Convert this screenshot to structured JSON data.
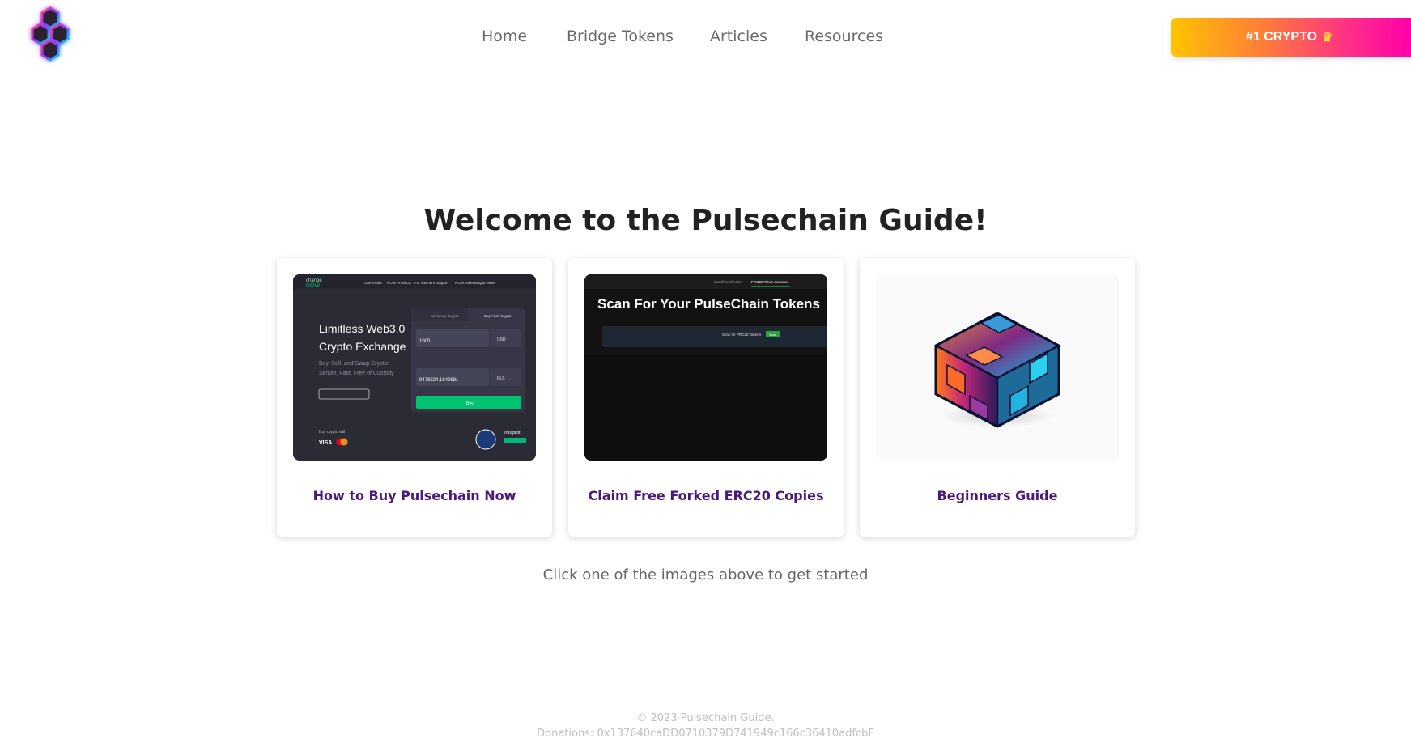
{
  "nav": {
    "items": [
      "Home",
      "Bridge Tokens",
      "Articles",
      "Resources"
    ],
    "cta_label": "#1 CRYPTO",
    "cta_icon": "crown-icon"
  },
  "hero": {
    "title": "Welcome to the Pulsechain Guide!",
    "subtitle": "Click one of the images above to get started"
  },
  "cards": [
    {
      "label": "How to Buy Pulsechain Now",
      "thumb": {
        "brand_top": "change",
        "brand_bottom": "NOW",
        "menu": [
          "Currencies",
          "NOW Products",
          "For Partners",
          "Support",
          "NOW Token",
          "Blog & News"
        ],
        "headline_1": "Limitless Web3.0",
        "headline_2": "Crypto Exchange",
        "tagline_1": "Buy, Sell, and Swap Crypto:",
        "tagline_2": "Simple, Fast, Free of Custody",
        "tab_1": "Exchange Crypto",
        "tab_2": "Buy / Sell Crypto",
        "send_value": "1000",
        "send_currency": "USD",
        "get_value": "9478224.1849981",
        "get_currency": "PLS",
        "buy_button": "Buy",
        "pay_with": "Buy crypto with",
        "visa": "VISA",
        "trustpilot": "Trustpilot"
      }
    },
    {
      "label": "Claim Free Forked ERC20 Copies",
      "thumb": {
        "tab_1": "Sacrifice Checker",
        "tab_2": "PRC20 Token Scanner",
        "headline": "Scan For Your PulseChain Tokens",
        "scan_text": "Scan for PRC20 Tokens",
        "scan_button": "Scan"
      }
    },
    {
      "label": "Beginners Guide",
      "thumb": {}
    }
  ],
  "footer": {
    "copyright": "© 2023 Pulsechain Guide.",
    "donations": "Donations: 0x137640caDD0710379D741949c166c36410adfcbF"
  },
  "colors": {
    "card_label": "#4a1a7a",
    "cta_gradient_start": "#ffc400",
    "cta_gradient_end": "#ff00a8"
  }
}
